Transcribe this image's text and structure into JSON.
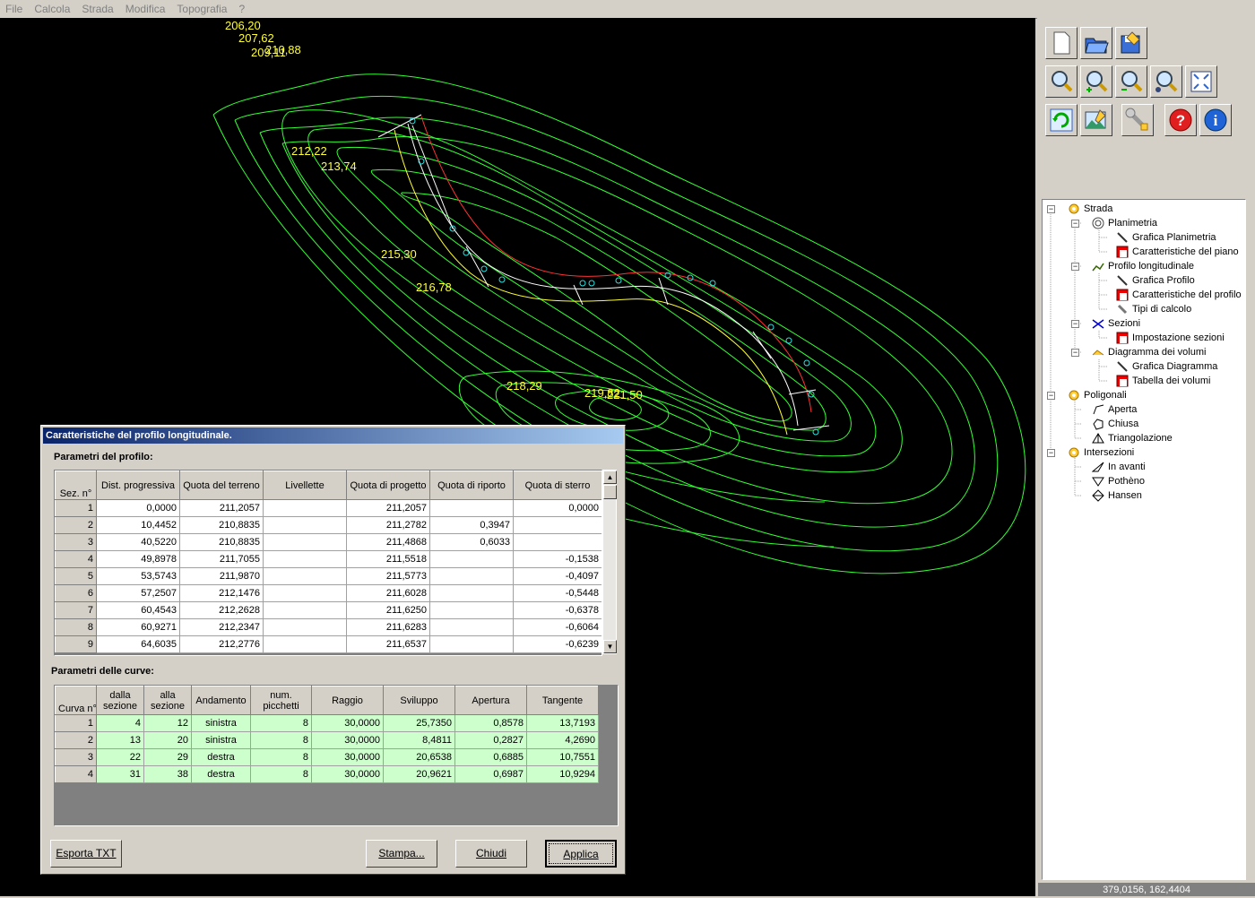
{
  "menu": [
    "File",
    "Calcola",
    "Strada",
    "Modifica",
    "Topografia",
    "?"
  ],
  "map_labels": [
    "206,20",
    "207,62",
    "209,11",
    "210,88",
    "212,22",
    "213,74",
    "215,30",
    "216,78",
    "218,29",
    "219,82",
    "221,50"
  ],
  "toolbar": {
    "row1": [
      "new-icon",
      "open-icon",
      "save-icon"
    ],
    "row2": [
      "zoom-window-icon",
      "zoom-in-icon",
      "zoom-out-icon",
      "zoom-realtime-icon",
      "zoom-extents-icon"
    ],
    "row3": [
      "regenerate-icon",
      "graphic-icon",
      "settings-icon",
      "help-icon",
      "info-icon"
    ]
  },
  "tree": [
    {
      "label": "Strada",
      "level": 0,
      "icon": "gear-icon",
      "toggle": "−"
    },
    {
      "label": "Planimetria",
      "level": 1,
      "icon": "spiral-icon",
      "toggle": "−"
    },
    {
      "label": "Grafica Planimetria",
      "level": 2,
      "icon": "pencil-icon"
    },
    {
      "label": "Caratteristiche del piano",
      "level": 2,
      "icon": "table-icon"
    },
    {
      "label": "Profilo longitudinale",
      "level": 1,
      "icon": "profile-icon",
      "toggle": "−"
    },
    {
      "label": "Grafica Profilo",
      "level": 2,
      "icon": "pencil-icon"
    },
    {
      "label": "Caratteristiche del profilo",
      "level": 2,
      "icon": "table-icon"
    },
    {
      "label": "Tipi di calcolo",
      "level": 2,
      "icon": "wrench-icon"
    },
    {
      "label": "Sezioni",
      "level": 1,
      "icon": "section-icon",
      "toggle": "−"
    },
    {
      "label": "Impostazione sezioni",
      "level": 2,
      "icon": "table-icon"
    },
    {
      "label": "Diagramma dei volumi",
      "level": 1,
      "icon": "diagram-icon",
      "toggle": "−"
    },
    {
      "label": "Grafica Diagramma",
      "level": 2,
      "icon": "pencil-icon"
    },
    {
      "label": "Tabella dei volumi",
      "level": 2,
      "icon": "table-icon"
    },
    {
      "label": "Poligonali",
      "level": 0,
      "icon": "gear-icon",
      "toggle": "−"
    },
    {
      "label": "Aperta",
      "level": 1,
      "icon": "polyline-icon"
    },
    {
      "label": "Chiusa",
      "level": 1,
      "icon": "polygon-icon"
    },
    {
      "label": "Triangolazione",
      "level": 1,
      "icon": "triangulation-icon"
    },
    {
      "label": "Intersezioni",
      "level": 0,
      "icon": "gear-icon",
      "toggle": "−"
    },
    {
      "label": "In avanti",
      "level": 1,
      "icon": "forward-icon"
    },
    {
      "label": "Pothèno",
      "level": 1,
      "icon": "pothenot-icon"
    },
    {
      "label": "Hansen",
      "level": 1,
      "icon": "hansen-icon"
    }
  ],
  "status": "379,0156,  162,4404",
  "dialog": {
    "title": "Caratteristiche del profilo longitudinale.",
    "profile_label": "Parametri del profilo:",
    "profile_headers": [
      "Sez. n°",
      "Dist. progressiva",
      "Quota del terreno",
      "Livellette",
      "Quota di progetto",
      "Quota di riporto",
      "Quota di sterro"
    ],
    "profile_rows": [
      [
        "1",
        "0,0000",
        "211,2057",
        "",
        "211,2057",
        "",
        "0,0000"
      ],
      [
        "2",
        "10,4452",
        "210,8835",
        "",
        "211,2782",
        "0,3947",
        ""
      ],
      [
        "3",
        "40,5220",
        "210,8835",
        "",
        "211,4868",
        "0,6033",
        ""
      ],
      [
        "4",
        "49,8978",
        "211,7055",
        "",
        "211,5518",
        "",
        "-0,1538"
      ],
      [
        "5",
        "53,5743",
        "211,9870",
        "",
        "211,5773",
        "",
        "-0,4097"
      ],
      [
        "6",
        "57,2507",
        "212,1476",
        "",
        "211,6028",
        "",
        "-0,5448"
      ],
      [
        "7",
        "60,4543",
        "212,2628",
        "",
        "211,6250",
        "",
        "-0,6378"
      ],
      [
        "8",
        "60,9271",
        "212,2347",
        "",
        "211,6283",
        "",
        "-0,6064"
      ],
      [
        "9",
        "64,6035",
        "212,2776",
        "",
        "211,6537",
        "",
        "-0,6239"
      ]
    ],
    "curves_label": "Parametri delle curve:",
    "curve_headers": [
      "Curva n°",
      "dalla sezione",
      "alla sezione",
      "Andamento",
      "num. picchetti",
      "Raggio",
      "Sviluppo",
      "Apertura",
      "Tangente"
    ],
    "curve_rows": [
      [
        "1",
        "4",
        "12",
        "sinistra",
        "8",
        "30,0000",
        "25,7350",
        "0,8578",
        "13,7193"
      ],
      [
        "2",
        "13",
        "20",
        "sinistra",
        "8",
        "30,0000",
        "8,4811",
        "0,2827",
        "4,2690"
      ],
      [
        "3",
        "22",
        "29",
        "destra",
        "8",
        "30,0000",
        "20,6538",
        "0,6885",
        "10,7551"
      ],
      [
        "4",
        "31",
        "38",
        "destra",
        "8",
        "30,0000",
        "20,9621",
        "0,6987",
        "10,9294"
      ]
    ],
    "buttons": {
      "export": "Esporta TXT",
      "print": "Stampa...",
      "close": "Chiudi",
      "apply": "Applica"
    }
  }
}
